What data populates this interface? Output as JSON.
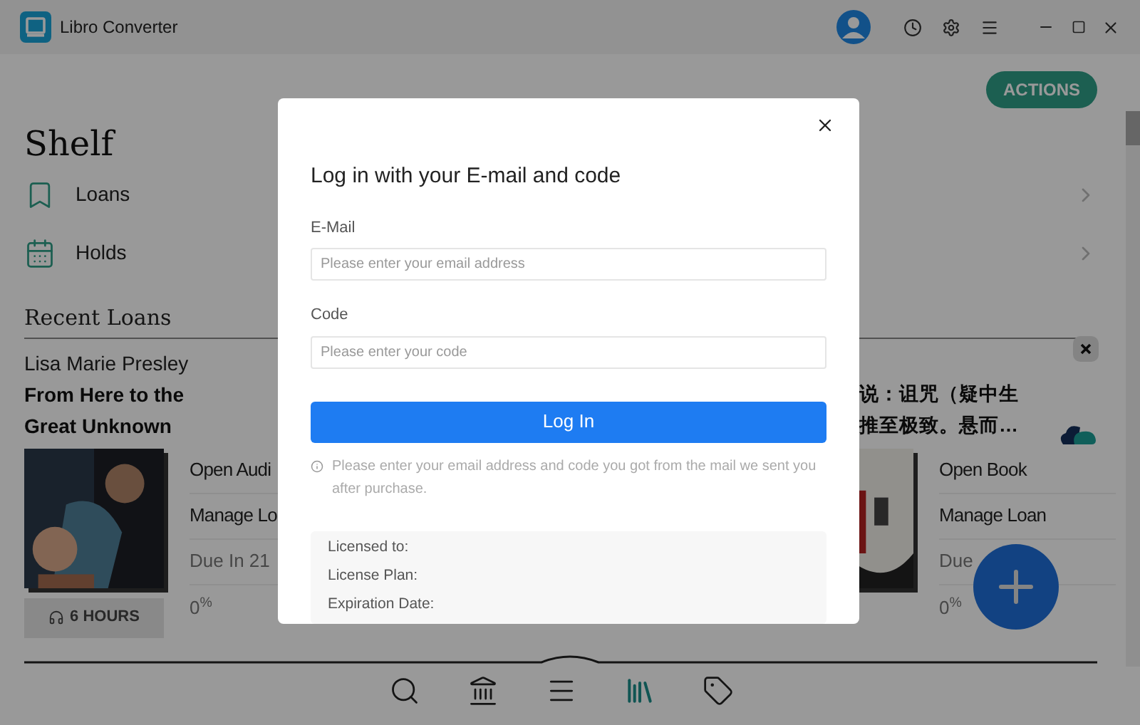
{
  "app": {
    "title": "Libro Converter"
  },
  "actions_button": "ACTIONS",
  "shelf": {
    "title": "Shelf",
    "items": [
      {
        "label": "Loans",
        "kind": "bookmark"
      },
      {
        "label": "Holds",
        "kind": "calendar"
      }
    ]
  },
  "recent_loans": {
    "title": "Recent Loans"
  },
  "loans": [
    {
      "kind": "audiobook",
      "author": "Lisa Marie Presley",
      "title_lines": [
        "From Here to the",
        "Great Unknown"
      ],
      "format_button": "6 HOURS",
      "actions": [
        "Open Audi",
        "Manage Lo"
      ],
      "due": "Due In 21",
      "progress": "0$^{%}$"
    },
    {
      "kind": "ebook",
      "title_lines": [
        "说：诅咒（疑中生",
        "推至极致。悬而…"
      ],
      "actions": [
        "Open Book",
        "Manage Loan"
      ],
      "due": "Due",
      "progress": "0$^{%}$"
    }
  ],
  "modal": {
    "title": "Log in with your E-mail and code",
    "fields": [
      {
        "label": "E-Mail",
        "placeholder": "Please enter your email address"
      },
      {
        "label": "Code",
        "placeholder": "Please enter your code"
      }
    ],
    "login_button": "Log In",
    "hint": "Please enter your email address and code you got from the mail we sent you after purchase.",
    "license": [
      "Licensed to:",
      "License Plan:",
      "Expiration Date:"
    ]
  },
  "nav": [
    {
      "kind": "search",
      "selected": false
    },
    {
      "kind": "library",
      "selected": false
    },
    {
      "kind": "menu",
      "selected": false
    },
    {
      "kind": "books",
      "selected": true
    },
    {
      "kind": "tag",
      "selected": false
    }
  ]
}
